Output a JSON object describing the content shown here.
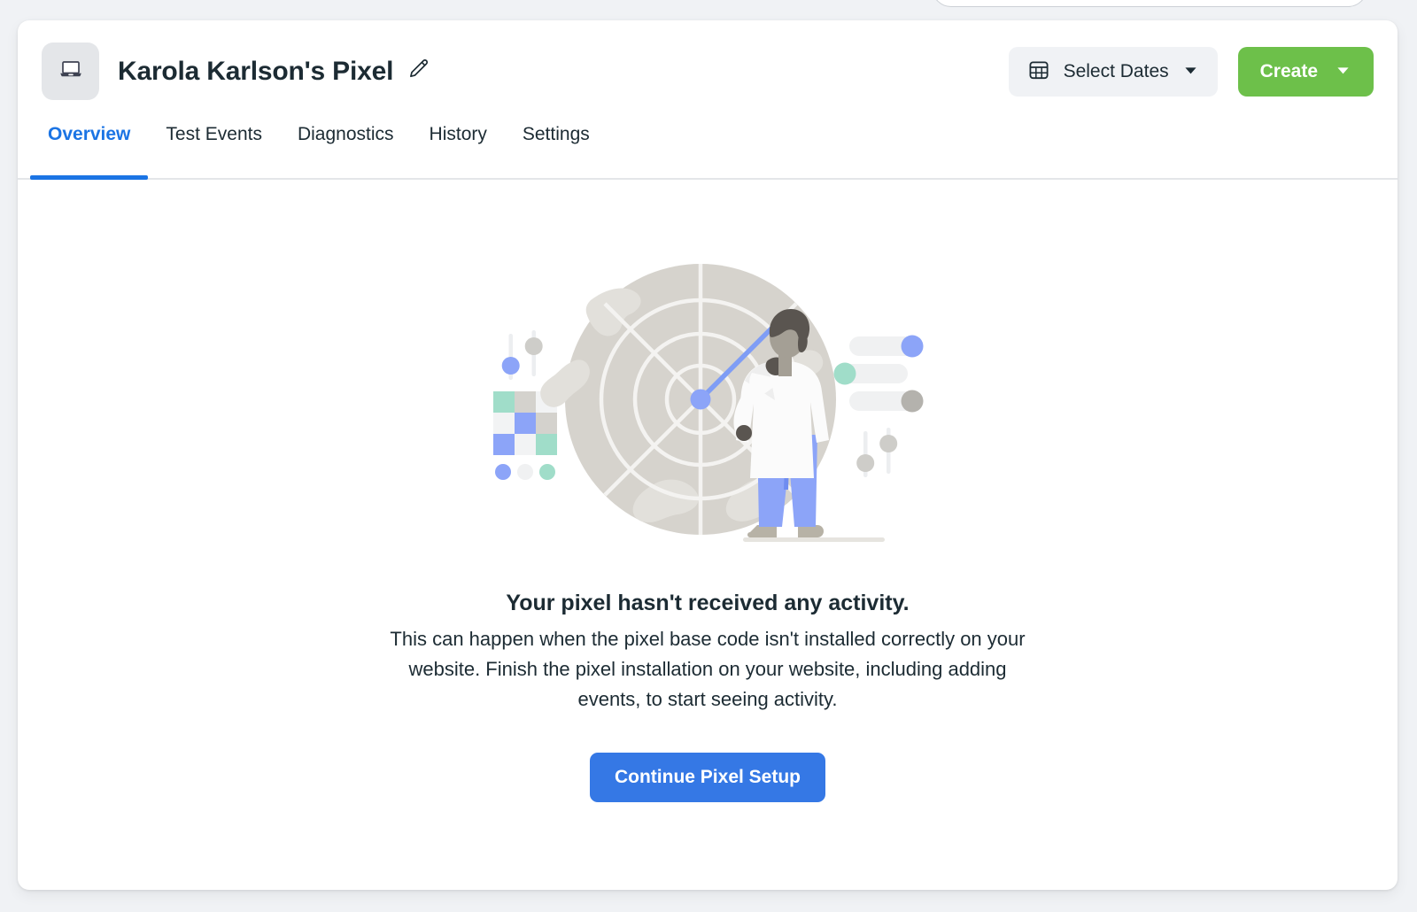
{
  "top_cutoff": {
    "name": "search-box-partial"
  },
  "header": {
    "avatar_icon": "laptop-icon",
    "title": "Karola Karlson's Pixel",
    "edit_icon": "pencil-icon",
    "select_dates": {
      "icon": "calendar-icon",
      "label": "Select Dates",
      "caret": "chevron-down-icon"
    },
    "create": {
      "label": "Create",
      "caret": "chevron-down-icon"
    }
  },
  "tabs": [
    {
      "label": "Overview",
      "active": true
    },
    {
      "label": "Test Events",
      "active": false
    },
    {
      "label": "Diagnostics",
      "active": false
    },
    {
      "label": "History",
      "active": false
    },
    {
      "label": "Settings",
      "active": false
    }
  ],
  "empty_state": {
    "illustration": "radar-globe-with-analyst-illustration",
    "title": "Your pixel hasn't received any activity.",
    "description": "This can happen when the pixel base code isn't installed correctly on your website. Finish the pixel installation on your website, including adding events, to start seeing activity.",
    "cta_label": "Continue Pixel Setup"
  },
  "colors": {
    "page_background": "#f0f2f5",
    "card_background": "#ffffff",
    "accent_blue": "#1b74e4",
    "cta_blue": "#3578e5",
    "create_green": "#6dc04a",
    "text_primary": "#1c2b33",
    "radar_gray": "#d6d3cd",
    "illustration_blue": "#8ca4f8",
    "illustration_teal": "#a0ddc9"
  }
}
